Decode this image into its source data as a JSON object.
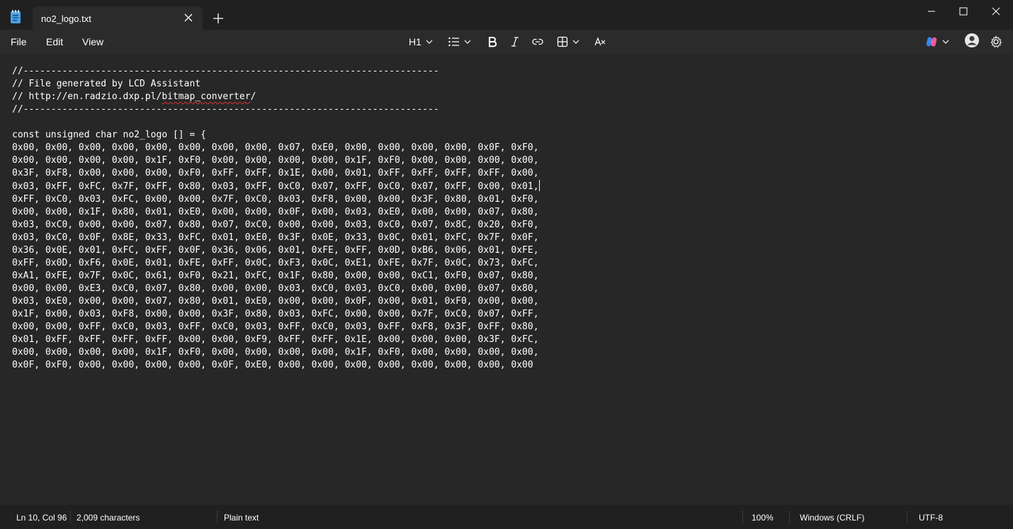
{
  "tab": {
    "title": "no2_logo.txt"
  },
  "menu": {
    "file": "File",
    "edit": "Edit",
    "view": "View"
  },
  "toolbar": {
    "heading": "H1"
  },
  "editor": {
    "lines": [
      "//---------------------------------------------------------------------------",
      "// File generated by LCD Assistant",
      "// http://en.radzio.dxp.pl/bitmap_converter/",
      "//---------------------------------------------------------------------------",
      "",
      "const unsigned char no2_logo [] = {",
      "0x00, 0x00, 0x00, 0x00, 0x00, 0x00, 0x00, 0x00, 0x07, 0xE0, 0x00, 0x00, 0x00, 0x00, 0x0F, 0xF0,",
      "0x00, 0x00, 0x00, 0x00, 0x1F, 0xF0, 0x00, 0x00, 0x00, 0x00, 0x1F, 0xF0, 0x00, 0x00, 0x00, 0x00,",
      "0x3F, 0xF8, 0x00, 0x00, 0x00, 0xF0, 0xFF, 0xFF, 0x1E, 0x00, 0x01, 0xFF, 0xFF, 0xFF, 0xFF, 0x00,",
      "0x03, 0xFF, 0xFC, 0x7F, 0xFF, 0x80, 0x03, 0xFF, 0xC0, 0x07, 0xFF, 0xC0, 0x07, 0xFF, 0x00, 0x01,",
      "0xFF, 0xC0, 0x03, 0xFC, 0x00, 0x00, 0x7F, 0xC0, 0x03, 0xF8, 0x00, 0x00, 0x3F, 0x80, 0x01, 0xF0,",
      "0x00, 0x00, 0x1F, 0x80, 0x01, 0xE0, 0x00, 0x00, 0x0F, 0x00, 0x03, 0xE0, 0x00, 0x00, 0x07, 0x80,",
      "0x03, 0xC0, 0x00, 0x00, 0x07, 0x80, 0x07, 0xC0, 0x00, 0x00, 0x03, 0xC0, 0x07, 0x8C, 0x20, 0xF0,",
      "0x03, 0xC0, 0x0F, 0x8E, 0x33, 0xFC, 0x01, 0xE0, 0x3F, 0x0E, 0x33, 0x0C, 0x01, 0xFC, 0x7F, 0x0F,",
      "0x36, 0x0E, 0x01, 0xFC, 0xFF, 0x0F, 0x36, 0x06, 0x01, 0xFE, 0xFF, 0x0D, 0xB6, 0x06, 0x01, 0xFE,",
      "0xFF, 0x0D, 0xF6, 0x0E, 0x01, 0xFE, 0xFF, 0x0C, 0xF3, 0x0C, 0xE1, 0xFE, 0x7F, 0x0C, 0x73, 0xFC,",
      "0xA1, 0xFE, 0x7F, 0x0C, 0x61, 0xF0, 0x21, 0xFC, 0x1F, 0x80, 0x00, 0x00, 0xC1, 0xF0, 0x07, 0x80,",
      "0x00, 0x00, 0xE3, 0xC0, 0x07, 0x80, 0x00, 0x00, 0x03, 0xC0, 0x03, 0xC0, 0x00, 0x00, 0x07, 0x80,",
      "0x03, 0xE0, 0x00, 0x00, 0x07, 0x80, 0x01, 0xE0, 0x00, 0x00, 0x0F, 0x00, 0x01, 0xF0, 0x00, 0x00,",
      "0x1F, 0x00, 0x03, 0xF8, 0x00, 0x00, 0x3F, 0x80, 0x03, 0xFC, 0x00, 0x00, 0x7F, 0xC0, 0x07, 0xFF,",
      "0x00, 0x00, 0xFF, 0xC0, 0x03, 0xFF, 0xC0, 0x03, 0xFF, 0xC0, 0x03, 0xFF, 0xF8, 0x3F, 0xFF, 0x80,",
      "0x01, 0xFF, 0xFF, 0xFF, 0xFF, 0x00, 0x00, 0xF9, 0xFF, 0xFF, 0x1E, 0x00, 0x00, 0x00, 0x3F, 0xFC,",
      "0x00, 0x00, 0x00, 0x00, 0x1F, 0xF0, 0x00, 0x00, 0x00, 0x00, 0x1F, 0xF0, 0x00, 0x00, 0x00, 0x00,",
      "0x0F, 0xF0, 0x00, 0x00, 0x00, 0x00, 0x0F, 0xE0, 0x00, 0x00, 0x00, 0x00, 0x00, 0x00, 0x00, 0x00",
      "};"
    ],
    "url_prefix": "// http://en.radzio.dxp.pl/",
    "url_misspelled": "bitmap_converter",
    "url_suffix": "/"
  },
  "status": {
    "position": "Ln 10, Col 96",
    "characters": "2,009 characters",
    "format": "Plain text",
    "zoom": "100%",
    "line_ending": "Windows (CRLF)",
    "encoding": "UTF-8"
  },
  "colors": {
    "titlebar": "#202020",
    "menubar": "#2b2b2b",
    "editor": "#272727",
    "spell_error": "#e03030",
    "notepad_blue": "#4aa3e8"
  }
}
